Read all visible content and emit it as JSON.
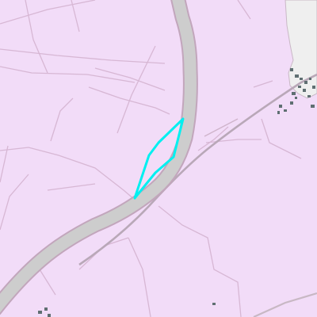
{
  "map": {
    "style": "land-cover tile with river channel and boundary lines",
    "colors": {
      "land": "#f2dcf8",
      "river_outer": "#c2a6bc",
      "river_fill": "#cdcdcd",
      "field_line": "#d7b7d4",
      "road_line": "#b9a8b8",
      "built_area": "#efefef",
      "buildings": "#5f6f72",
      "highlight": "#00f0f0"
    },
    "features": [
      {
        "kind": "river",
        "name": ""
      },
      {
        "kind": "railway-or-road",
        "name": ""
      },
      {
        "kind": "built-up-area",
        "name": ""
      },
      {
        "kind": "highlighted-parcel",
        "name": ""
      }
    ],
    "labels": []
  }
}
